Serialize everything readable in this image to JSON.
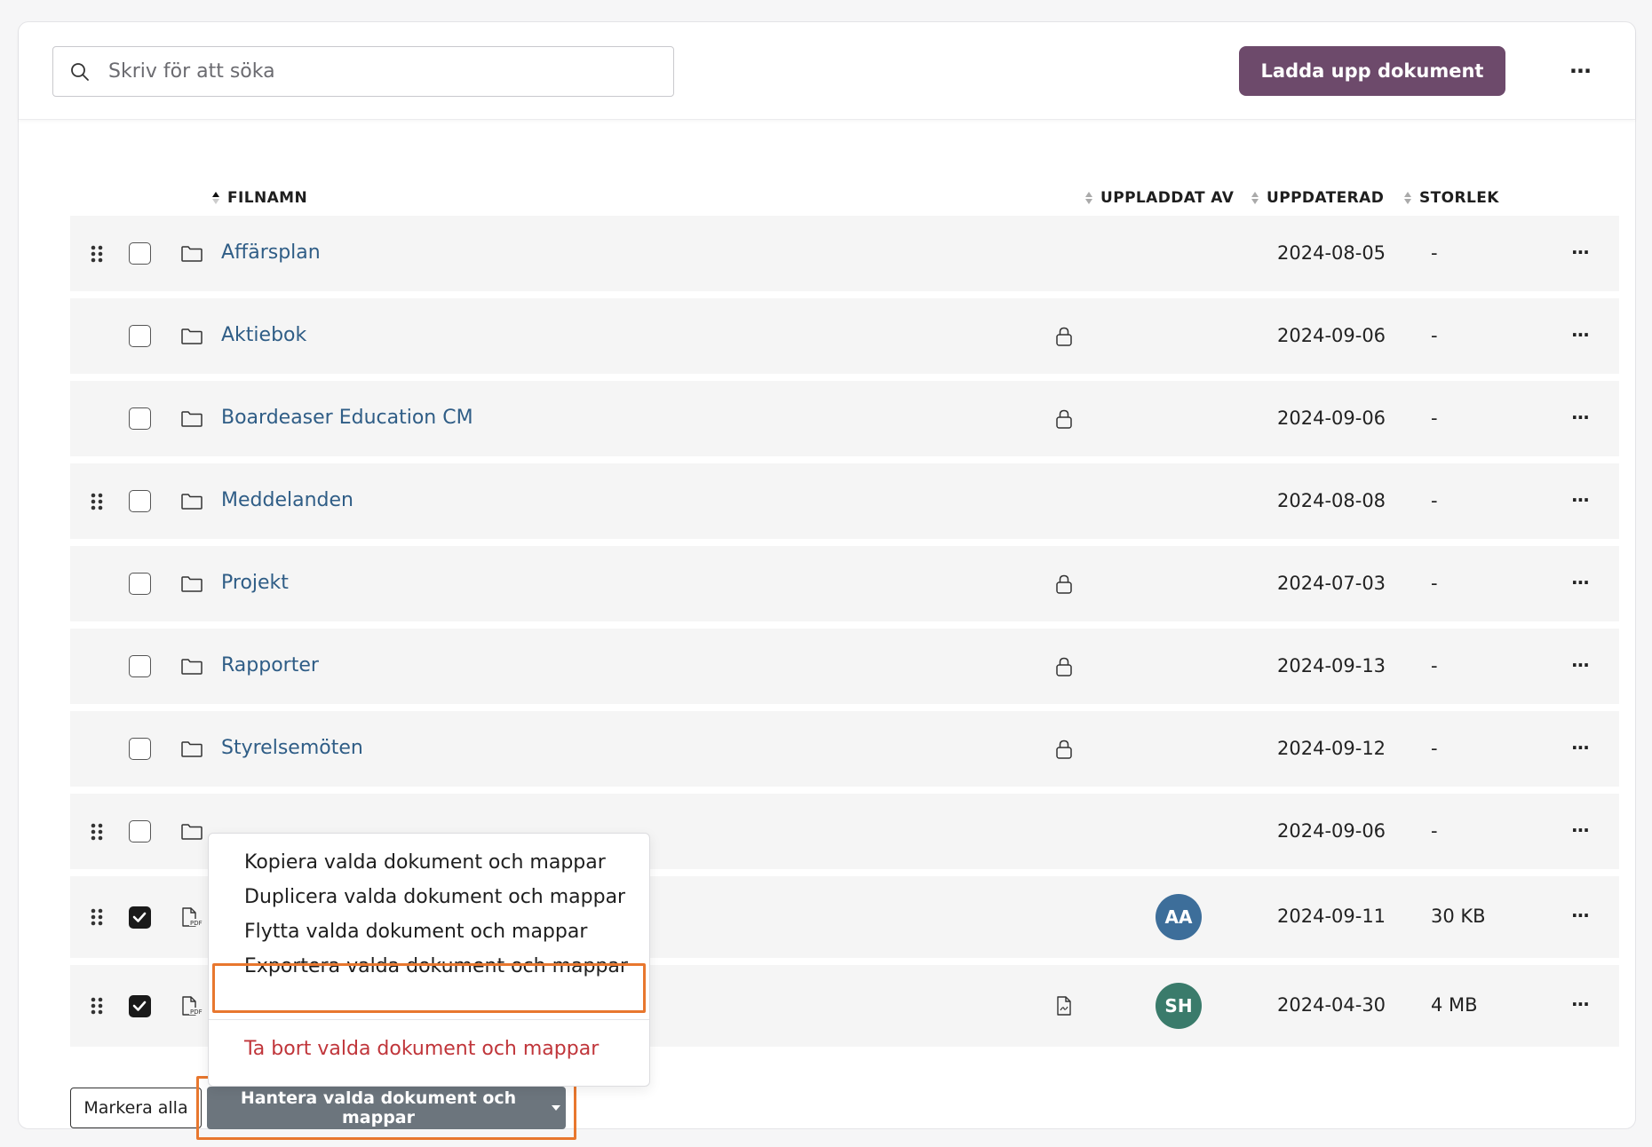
{
  "search": {
    "placeholder": "Skriv för att söka"
  },
  "toolbar": {
    "upload_label": "Ladda upp dokument",
    "more_label": "···"
  },
  "table": {
    "columns": {
      "filename": "FILNAMN",
      "uploaded_by": "UPPLADDAT AV",
      "updated": "UPPDATERAD",
      "size": "STORLEK"
    },
    "rows": [
      {
        "name": "Affärsplan",
        "updated": "2024-08-05",
        "size": "-",
        "locked": false,
        "draggable": true,
        "checked": false,
        "type": "folder"
      },
      {
        "name": "Aktiebok",
        "updated": "2024-09-06",
        "size": "-",
        "locked": true,
        "draggable": false,
        "checked": false,
        "type": "folder"
      },
      {
        "name": "Boardeaser Education CM",
        "updated": "2024-09-06",
        "size": "-",
        "locked": true,
        "draggable": false,
        "checked": false,
        "type": "folder"
      },
      {
        "name": "Meddelanden",
        "updated": "2024-08-08",
        "size": "-",
        "locked": false,
        "draggable": true,
        "checked": false,
        "type": "folder"
      },
      {
        "name": "Projekt",
        "updated": "2024-07-03",
        "size": "-",
        "locked": true,
        "draggable": false,
        "checked": false,
        "type": "folder"
      },
      {
        "name": "Rapporter",
        "updated": "2024-09-13",
        "size": "-",
        "locked": true,
        "draggable": false,
        "checked": false,
        "type": "folder"
      },
      {
        "name": "Styrelsemöten",
        "updated": "2024-09-12",
        "size": "-",
        "locked": true,
        "draggable": false,
        "checked": false,
        "type": "folder"
      },
      {
        "name": "",
        "updated": "2024-09-06",
        "size": "-",
        "locked": false,
        "draggable": true,
        "checked": false,
        "type": "folder"
      },
      {
        "name": "",
        "updated": "2024-09-11",
        "size": "30 KB",
        "locked": false,
        "draggable": true,
        "checked": true,
        "type": "pdf",
        "uploader_initials": "AA",
        "uploader_color": "#3d6e9a"
      },
      {
        "name": "",
        "updated": "2024-04-30",
        "size": "4 MB",
        "locked": false,
        "draggable": true,
        "checked": true,
        "type": "pdf",
        "uploader_initials": "SH",
        "uploader_color": "#3a7b6b",
        "has_doc_icon": true
      }
    ],
    "row_more_label": "···"
  },
  "menu": {
    "items": [
      "Kopiera valda dokument och mappar",
      "Duplicera valda dokument och mappar",
      "Flytta valda dokument och mappar",
      "Exportera valda dokument och mappar"
    ],
    "danger_item": "Ta bort valda dokument och mappar"
  },
  "footer": {
    "mark_all_label": "Markera alla",
    "manage_label": "Hantera valda dokument och mappar"
  },
  "colors": {
    "accent": "#6d4a6b",
    "link": "#2f5d86",
    "highlight": "#e8772e",
    "danger": "#c0353a",
    "manage_button": "#6c757d"
  }
}
